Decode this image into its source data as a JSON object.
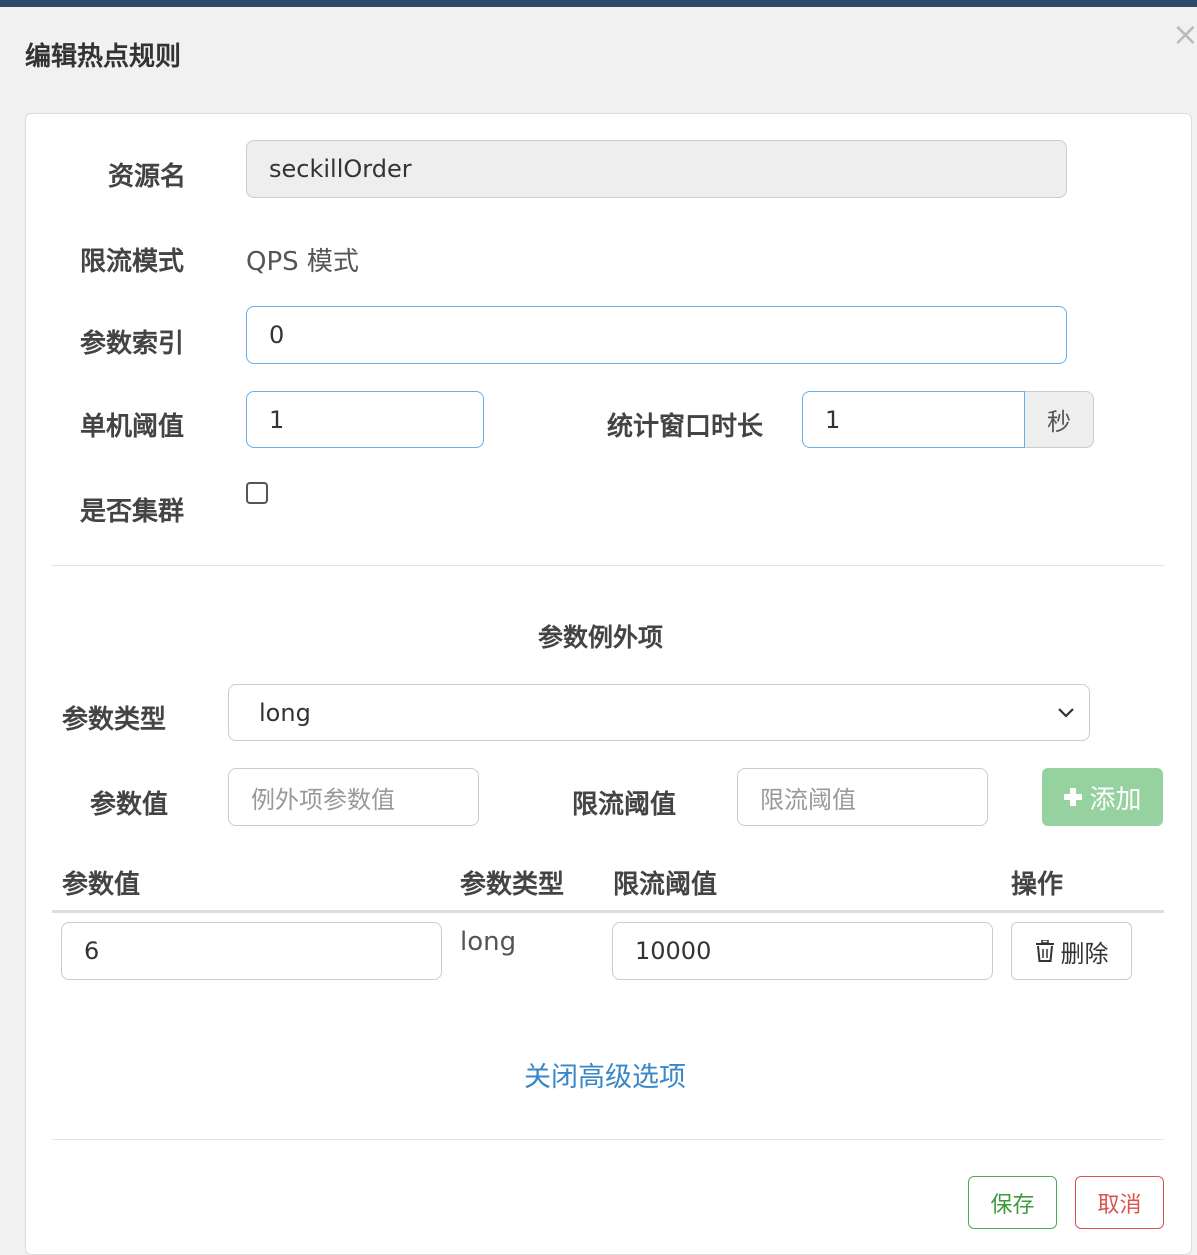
{
  "dialog": {
    "title": "编辑热点规则",
    "close_icon": "×"
  },
  "form": {
    "resource_label": "资源名",
    "resource_value": "seckillOrder",
    "mode_label": "限流模式",
    "mode_value": "QPS 模式",
    "param_index_label": "参数索引",
    "param_index_value": "0",
    "threshold_label": "单机阈值",
    "threshold_value": "1",
    "window_label": "统计窗口时长",
    "window_value": "1",
    "window_unit": "秒",
    "cluster_label": "是否集群",
    "cluster_checked": false
  },
  "exceptions": {
    "section_title": "参数例外项",
    "param_type_label": "参数类型",
    "param_type_selected": "long",
    "param_value_label": "参数值",
    "param_value_placeholder": "例外项参数值",
    "limit_label": "限流阈值",
    "limit_placeholder": "限流阈值",
    "add_button": "添加",
    "table": {
      "columns": [
        "参数值",
        "参数类型",
        "限流阈值",
        "操作"
      ],
      "rows": [
        {
          "param_value": "6",
          "param_type": "long",
          "limit": "10000",
          "delete_label": "删除"
        }
      ]
    }
  },
  "advanced_toggle": "关闭高级选项",
  "footer": {
    "save_label": "保存",
    "cancel_label": "取消"
  },
  "colors": {
    "link": "#3a87c8",
    "save": "#4cae4c",
    "cancel": "#d9534f",
    "add_button": "#95d2a0"
  }
}
